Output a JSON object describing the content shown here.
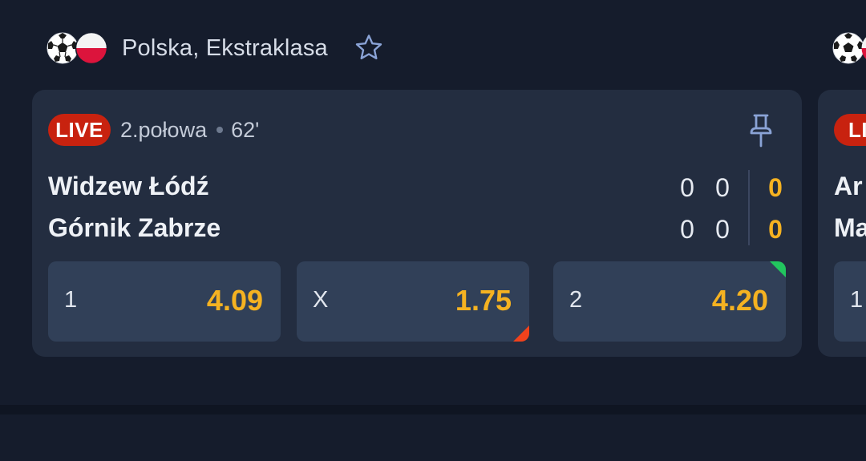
{
  "groups": [
    {
      "league": "Polska, Ekstraklasa",
      "live_label": "LIVE",
      "period": "2.połowa",
      "minute": "62'",
      "home_team": "Widzew Łódź",
      "away_team": "Górnik Zabrze",
      "home_scores": [
        "0",
        "0",
        "0"
      ],
      "away_scores": [
        "0",
        "0",
        "0"
      ],
      "odds": [
        {
          "label": "1",
          "value": "4.09",
          "trend": "none"
        },
        {
          "label": "X",
          "value": "1.75",
          "trend": "down"
        },
        {
          "label": "2",
          "value": "4.20",
          "trend": "up"
        }
      ]
    },
    {
      "live_label": "LIV",
      "home_team": "Ar",
      "away_team": "Ma",
      "odds": [
        {
          "label": "1"
        }
      ]
    }
  ],
  "colors": {
    "background": "#151c2c",
    "card": "#232d40",
    "odd_button": "#314058",
    "live_badge": "#c8220f",
    "odd_value": "#f5b221",
    "trend_up": "#22c55e",
    "trend_down": "#f0421c"
  },
  "icons": {
    "sport": "soccer-ball-icon",
    "flag": "poland-flag-icon",
    "favorite": "star-outline-icon",
    "pin": "pin-icon"
  }
}
